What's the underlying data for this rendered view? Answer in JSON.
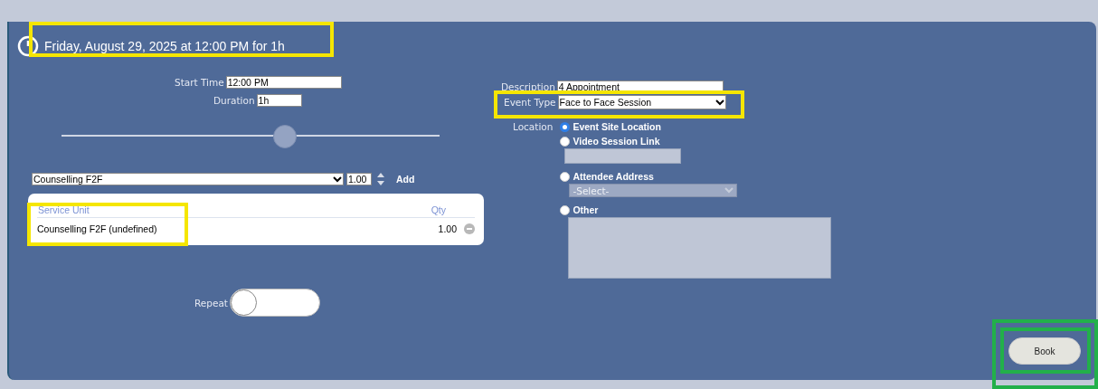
{
  "header": {
    "title": "Friday, August 29, 2025 at 12:00 PM for 1h"
  },
  "start_time": {
    "label": "Start Time",
    "value": "12:00 PM"
  },
  "duration": {
    "label": "Duration",
    "value": "1h"
  },
  "time_slider": {
    "level": 0.59
  },
  "service_picker": {
    "value": "Counselling F2F",
    "qty": "1.00",
    "add": "Add"
  },
  "service_table": {
    "columns": [
      "Service Unit",
      "Qty"
    ],
    "rows": [
      {
        "service_unit": "Counselling F2F (undefined)",
        "qty": "1.00"
      }
    ]
  },
  "repeat": {
    "label": "Repeat",
    "on": false
  },
  "description": {
    "label": "Description",
    "value": "4 Appointment"
  },
  "event_type": {
    "label": "Event Type",
    "value": "Face to Face Session"
  },
  "location": {
    "label": "Location",
    "options": [
      {
        "label": "Event Site Location",
        "selected": true,
        "kind": "plain"
      },
      {
        "label": "Video Session Link",
        "selected": false,
        "kind": "text"
      },
      {
        "label": "Attendee Address",
        "selected": false,
        "kind": "select",
        "placeholder": "-Select-"
      },
      {
        "label": "Other",
        "selected": false,
        "kind": "textarea"
      }
    ]
  },
  "book_button": "Book"
}
